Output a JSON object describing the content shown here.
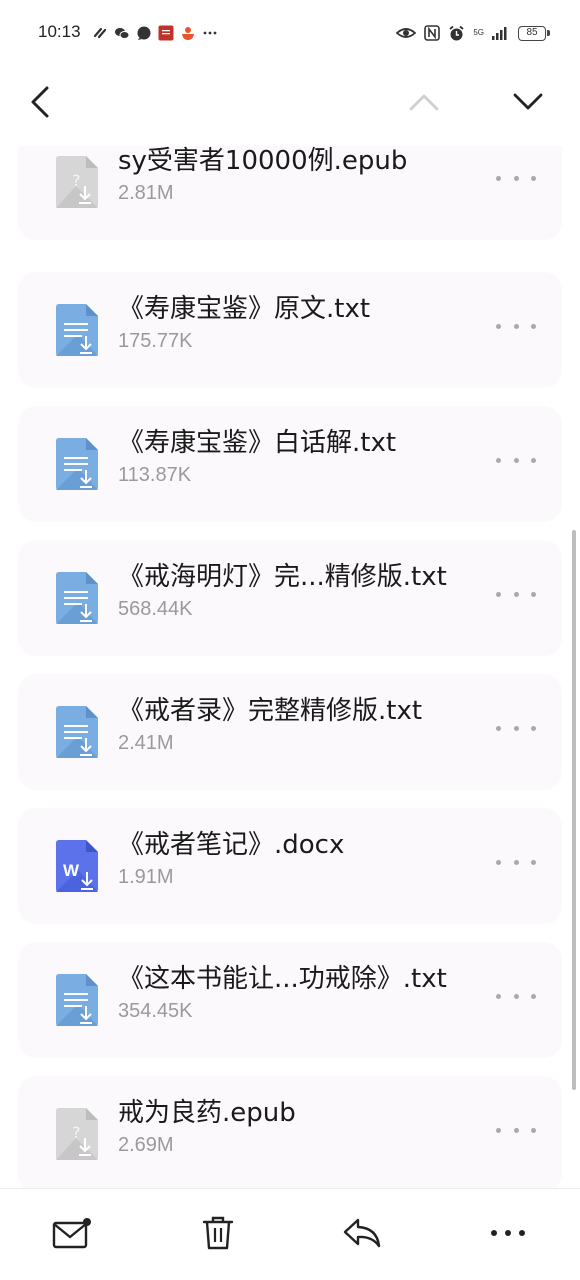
{
  "status_bar": {
    "time": "10:13",
    "battery": "85",
    "network": "5G",
    "notification_icons": [
      "link-icon",
      "wechat-icon",
      "chat-bubble-icon",
      "app-red-icon",
      "app-bowl-icon",
      "more-dots-icon"
    ],
    "system_icons": [
      "eye-icon",
      "nfc-icon",
      "alarm-icon",
      "signal-icon",
      "battery-icon"
    ]
  },
  "nav": {
    "back_icon": "chevron-left-icon",
    "up_icon": "chevron-up-icon",
    "down_icon": "chevron-down-icon"
  },
  "files": [
    {
      "name": "sy受害者10000例.epub",
      "size": "2.81M",
      "type": "epub"
    },
    {
      "name": "《寿康宝鉴》原文.txt",
      "size": "175.77K",
      "type": "txt"
    },
    {
      "name": "《寿康宝鉴》白话解.txt",
      "size": "113.87K",
      "type": "txt"
    },
    {
      "name": "《戒海明灯》完...精修版.txt",
      "size": "568.44K",
      "type": "txt"
    },
    {
      "name": "《戒者录》完整精修版.txt",
      "size": "2.41M",
      "type": "txt"
    },
    {
      "name": "《戒者笔记》.docx",
      "size": "1.91M",
      "type": "docx"
    },
    {
      "name": "《这本书能让...功戒除》.txt",
      "size": "354.45K",
      "type": "txt"
    },
    {
      "name": "戒为良药.epub",
      "size": "2.69M",
      "type": "epub"
    }
  ],
  "toolbar": {
    "items": [
      "mail-icon",
      "trash-icon",
      "reply-icon",
      "more-icon"
    ]
  },
  "colors": {
    "card_bg": "#fcf9fc",
    "txt_icon": "#6a9fd6",
    "docx_icon": "#4c63e0",
    "epub_icon": "#cfcfcf",
    "size_text": "#9a9a9a"
  }
}
